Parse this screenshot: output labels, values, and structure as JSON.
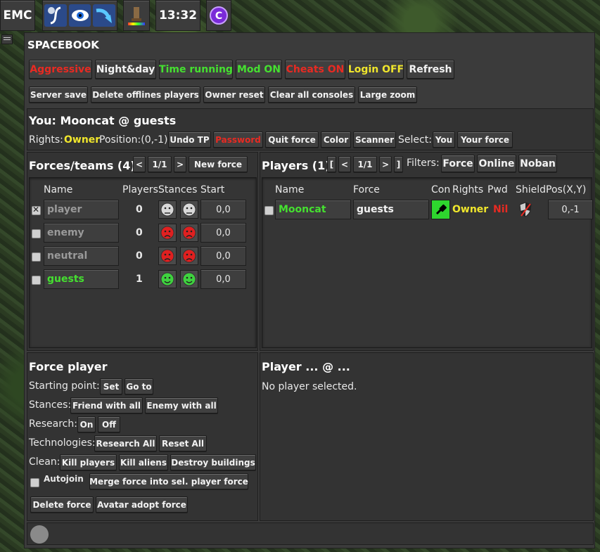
{
  "topbar": {
    "emc": "EMC",
    "clock": "13:32"
  },
  "window": {
    "title": "SPACEBOOK"
  },
  "toggles": [
    {
      "label": "Aggressive",
      "color": "#e82a22"
    },
    {
      "label": "Night&day",
      "color": "#f2f2f2"
    },
    {
      "label": "Time running",
      "color": "#45e030"
    },
    {
      "label": "Mod ON",
      "color": "#45e030"
    },
    {
      "label": "Cheats ON",
      "color": "#e82a22"
    },
    {
      "label": "Login OFF",
      "color": "#f0e62c"
    },
    {
      "label": "Refresh",
      "color": "#f2f2f2"
    }
  ],
  "actions": [
    "Server save",
    "Delete offlines players",
    "Owner reset",
    "Clear all consoles",
    "Large zoom"
  ],
  "you": {
    "heading": "You: Mooncat @ guests",
    "rights_label": "Rights:",
    "rights_value": "Owner",
    "position": "Position:(0,-1)",
    "undo_tp": "Undo TP",
    "password": "Password",
    "quit_force": "Quit force",
    "color": "Color",
    "scanner": "Scanner",
    "select_label": "Select:",
    "select_you": "You",
    "select_your_force": "Your force"
  },
  "forces": {
    "heading": "Forces/teams (4)",
    "prev": "<",
    "page": "1/1",
    "next": ">",
    "new_force": "New force",
    "columns": {
      "name": "Name",
      "players": "Players",
      "stances": "Stances",
      "start": "Start"
    },
    "rows": [
      {
        "name": "player",
        "players": "0",
        "start": "0,0",
        "color": "#9a9a9a",
        "checked": true,
        "stance": "neutral"
      },
      {
        "name": "enemy",
        "players": "0",
        "start": "0,0",
        "color": "#9a9a9a",
        "checked": false,
        "stance": "enemy"
      },
      {
        "name": "neutral",
        "players": "0",
        "start": "0,0",
        "color": "#9a9a9a",
        "checked": false,
        "stance": "enemy"
      },
      {
        "name": "guests",
        "players": "1",
        "start": "0,0",
        "color": "#45e030",
        "checked": false,
        "stance": "friend"
      }
    ]
  },
  "players": {
    "heading": "Players (1)",
    "first": "[",
    "prev": "<",
    "page": "1/1",
    "next": ">",
    "last": "]",
    "filters_label": "Filters:",
    "filter_force": "Force",
    "filter_online": "Online",
    "filter_noban": "Noban",
    "columns": {
      "name": "Name",
      "force": "Force",
      "con": "Con",
      "rights": "Rights",
      "pwd": "Pwd",
      "shield": "Shield",
      "pos": "Pos(X,Y)"
    },
    "rows": [
      {
        "name": "Mooncat",
        "force": "guests",
        "rights": "Owner",
        "pwd": "Nil",
        "pos": "0,-1"
      }
    ]
  },
  "force_player": {
    "heading": "Force player",
    "starting_point": "Starting point:",
    "set": "Set",
    "go_to": "Go to",
    "stances": "Stances:",
    "friend_all": "Friend with all",
    "enemy_all": "Enemy with all",
    "research": "Research:",
    "on": "On",
    "off": "Off",
    "technologies": "Technologies:",
    "research_all": "Research All",
    "reset_all": "Reset All",
    "clean": "Clean:",
    "kill_players": "Kill players",
    "kill_aliens": "Kill aliens",
    "destroy_buildings": "Destroy buildings",
    "autojoin": "Autojoin",
    "merge": "Merge force into sel. player force",
    "delete_force": "Delete force",
    "avatar_adopt": "Avatar adopt force"
  },
  "player_detail": {
    "heading": "Player ... @ ...",
    "empty": "No player selected."
  },
  "colors": {
    "green": "#45e030",
    "red": "#e82a22",
    "yellow": "#f0e62c",
    "panel": "#333333"
  }
}
